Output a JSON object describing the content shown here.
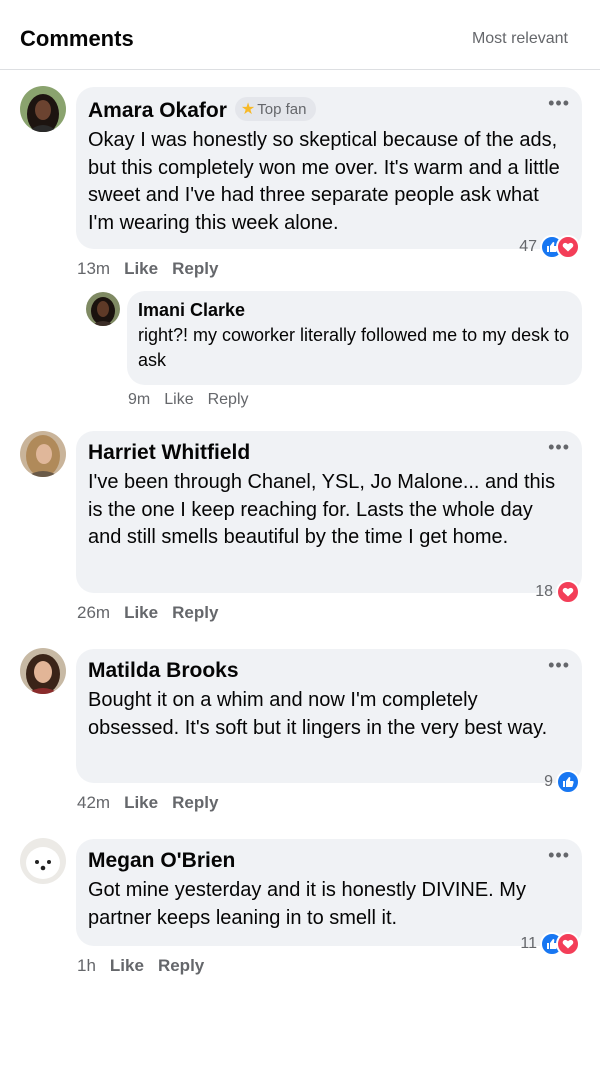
{
  "header": {
    "title": "Comments",
    "sort_label": "Most relevant"
  },
  "comments": [
    {
      "name": "Amara Okafor",
      "badge": "Top fan",
      "text": "Okay I was honestly so skeptical because of the ads, but this completely won me over. It's warm and a little sweet and I've had three separate people ask what I'm wearing this week alone.",
      "reactions": "47",
      "time": "13m",
      "like": "Like",
      "reply": "Reply",
      "replies": [
        {
          "name": "Imani Clarke",
          "text": "right?! my coworker literally followed me to my desk to ask",
          "time": "9m",
          "like": "Like",
          "reply": "Reply"
        }
      ]
    },
    {
      "name": "Harriet Whitfield",
      "text": "I've been through Chanel, YSL, Jo Malone... and this is the one I keep reaching for. Lasts the whole day and still smells beautiful by the time I get home.",
      "reactions": "18",
      "time": "26m",
      "like": "Like",
      "reply": "Reply"
    },
    {
      "name": "Matilda Brooks",
      "text": "Bought it on a whim and now I'm completely obsessed. It's soft but it lingers in the very best way.",
      "reactions": "9",
      "time": "42m",
      "like": "Like",
      "reply": "Reply"
    },
    {
      "name": "Megan O'Brien",
      "text": "Got mine yesterday and it is honestly DIVINE. My partner keeps leaning in to smell it.",
      "reactions": "11",
      "time": "1h",
      "like": "Like",
      "reply": "Reply"
    }
  ],
  "icons": {
    "more": "more-dots-icon",
    "like": "like-reaction-icon",
    "love": "love-reaction-icon",
    "star": "star-icon"
  },
  "colors": {
    "like": "#1877f2",
    "love": "#f33e58",
    "bubble": "#f0f2f5",
    "meta": "#65676b",
    "star": "#f7b928"
  }
}
